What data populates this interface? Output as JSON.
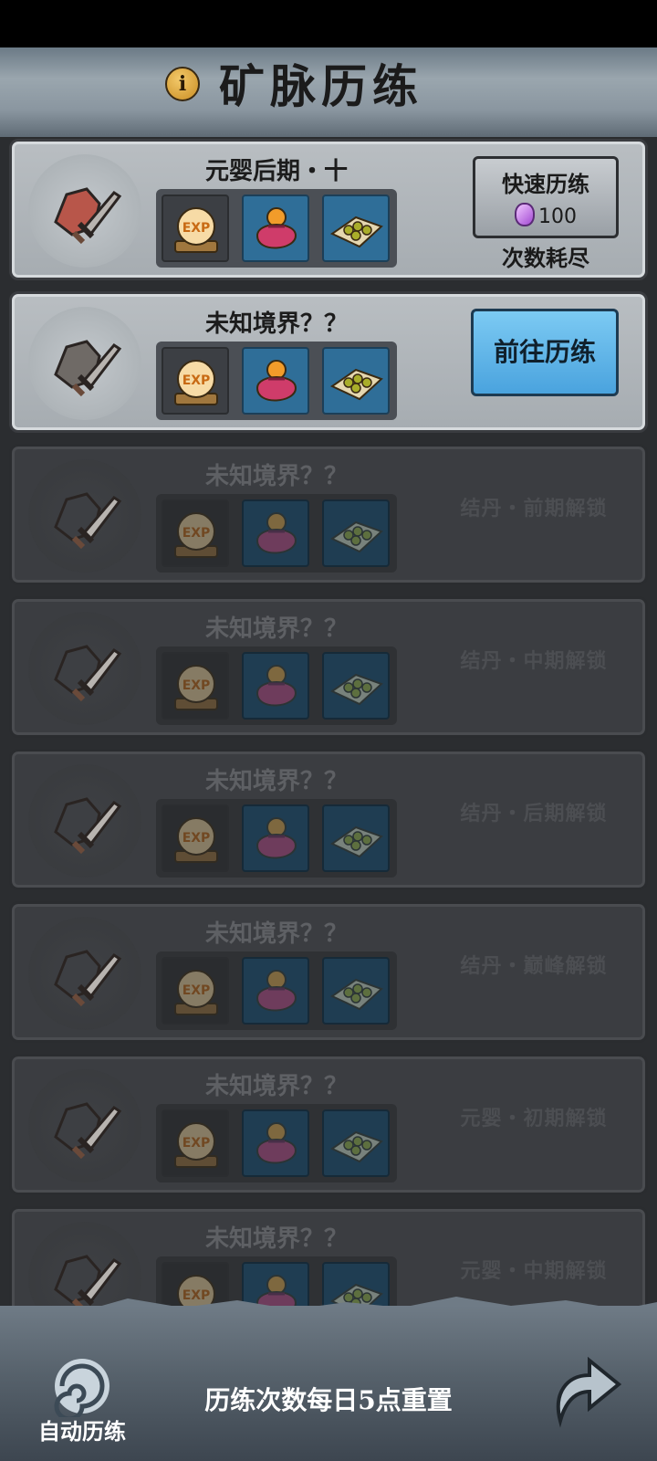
{
  "header": {
    "title": "矿脉历练",
    "info_icon": "i"
  },
  "cards": [
    {
      "name": "元婴后期・十",
      "state": "active",
      "quick_label": "快速历练",
      "quick_cost": "100",
      "exhausted_text": "次数耗尽",
      "emblem_color": "#b8564a"
    },
    {
      "name": "未知境界？？",
      "state": "open",
      "go_label": "前往历练",
      "emblem_color": "#6f6a66"
    },
    {
      "name": "未知境界？？",
      "state": "locked",
      "unlock_text": "结丹・前期解锁",
      "emblem_color": "#3d3f43"
    },
    {
      "name": "未知境界？？",
      "state": "locked",
      "unlock_text": "结丹・中期解锁",
      "emblem_color": "#3d3f43"
    },
    {
      "name": "未知境界？？",
      "state": "locked",
      "unlock_text": "结丹・后期解锁",
      "emblem_color": "#3d3f43"
    },
    {
      "name": "未知境界？？",
      "state": "locked",
      "unlock_text": "结丹・巅峰解锁",
      "emblem_color": "#3d3f43"
    },
    {
      "name": "未知境界？？",
      "state": "locked",
      "unlock_text": "元婴・初期解锁",
      "emblem_color": "#3d3f43"
    },
    {
      "name": "未知境界？？",
      "state": "locked",
      "unlock_text": "元婴・中期解锁",
      "emblem_color": "#3d3f43"
    }
  ],
  "reward_icons": [
    "exp-orb-icon",
    "treasure-pouch-icon",
    "spirit-beads-icon"
  ],
  "exp_text": "EXP",
  "footer": {
    "auto_label": "自动历练",
    "reset_note": "历练次数每日5点重置",
    "auto_icon": "swirl-icon",
    "back_icon": "return-arrow-icon"
  }
}
